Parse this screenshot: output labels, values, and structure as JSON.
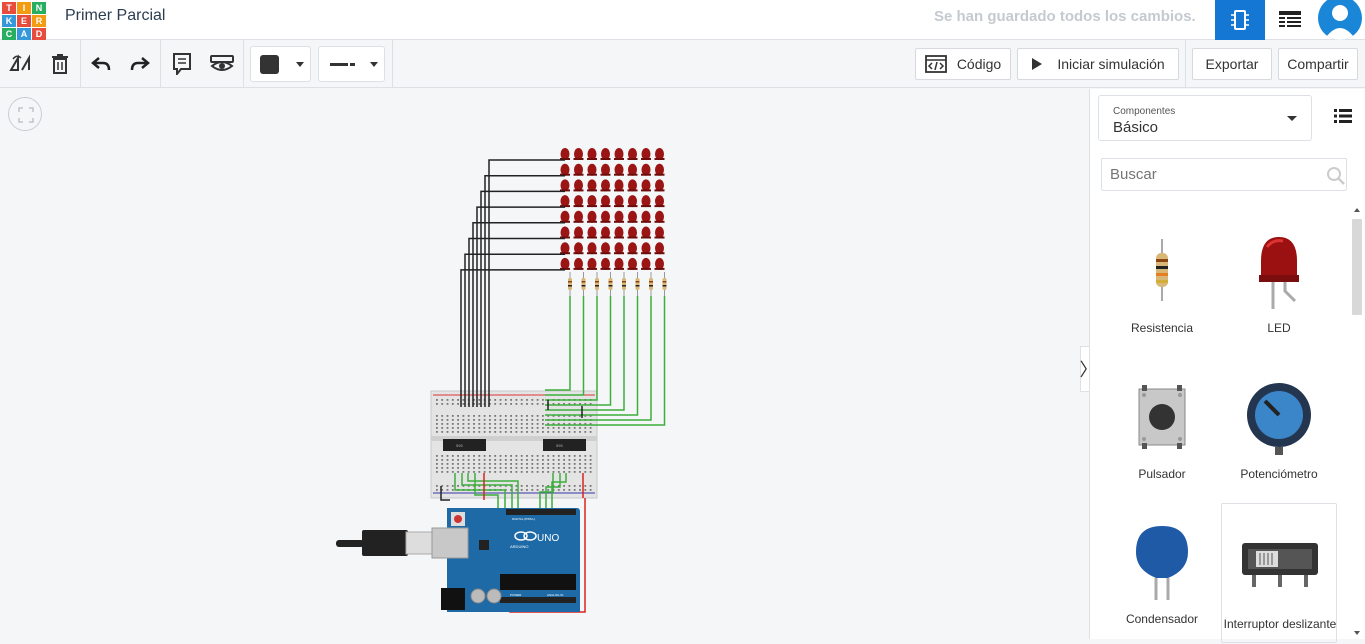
{
  "app": {
    "logo_letters": [
      "T",
      "I",
      "N",
      "K",
      "E",
      "R",
      "C",
      "A",
      "D"
    ],
    "logo_colors": [
      "#e74c3c",
      "#f39c12",
      "#27ae60",
      "#3498db",
      "#e74c3c",
      "#f39c12",
      "#27ae60",
      "#3498db",
      "#e74c3c"
    ],
    "project_title": "Primer Parcial",
    "save_status": "Se han guardado todos los cambios.",
    "accent": "#1477d4"
  },
  "toolbar": {
    "code_label": "Código",
    "simulate_label": "Iniciar simulación",
    "export_label": "Exportar",
    "share_label": "Compartir",
    "fill_color": "#333333"
  },
  "sidebar": {
    "category_label": "Componentes",
    "category_value": "Básico",
    "search_placeholder": "Buscar",
    "components": [
      {
        "name": "Resistencia",
        "icon": "resistor-icon"
      },
      {
        "name": "LED",
        "icon": "led-icon"
      },
      {
        "name": "Pulsador",
        "icon": "pushbutton-icon"
      },
      {
        "name": "Potenciómetro",
        "icon": "potentiometer-icon"
      },
      {
        "name": "Condensador",
        "icon": "capacitor-icon"
      },
      {
        "name": "Interruptor deslizante",
        "icon": "slide-switch-icon"
      }
    ]
  },
  "board": {
    "arduino_label": "UNO",
    "arduino_brand": "ARDUINO",
    "header_label": "DIGITAL (PWM~)",
    "power_label": "POWER",
    "analog_label": "ANALOG IN"
  }
}
